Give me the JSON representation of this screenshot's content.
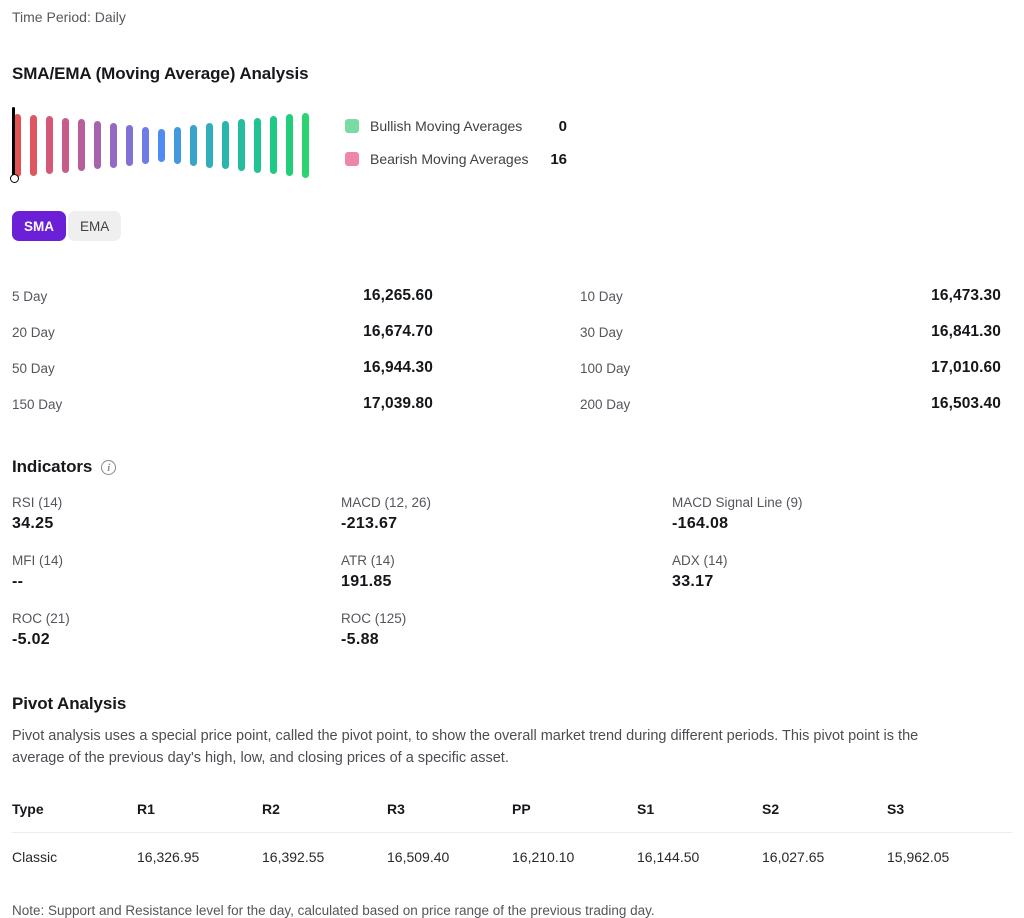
{
  "colors": {
    "accent_purple": "#6b1fd6",
    "toggle_inactive_bg": "#efefef",
    "bullish_swatch": "#79dba3",
    "bearish_swatch": "#ee87a5",
    "needle": "#000000"
  },
  "header": {
    "time_period": "Time Period: Daily"
  },
  "ma_section": {
    "title": "SMA/EMA (Moving Average) Analysis",
    "legend": {
      "bullish_label": "Bullish Moving Averages",
      "bullish_value": "0",
      "bearish_label": "Bearish Moving Averages",
      "bearish_value": "16"
    },
    "toggle": {
      "sma_label": "SMA",
      "ema_label": "EMA",
      "selected": "SMA"
    },
    "rows_left": [
      {
        "label": "5 Day",
        "value": "16,265.60"
      },
      {
        "label": "20 Day",
        "value": "16,674.70"
      },
      {
        "label": "50 Day",
        "value": "16,944.30"
      },
      {
        "label": "150 Day",
        "value": "17,039.80"
      }
    ],
    "rows_right": [
      {
        "label": "10 Day",
        "value": "16,473.30"
      },
      {
        "label": "30 Day",
        "value": "16,841.30"
      },
      {
        "label": "100 Day",
        "value": "17,010.60"
      },
      {
        "label": "200 Day",
        "value": "16,503.40"
      }
    ]
  },
  "chart_data": {
    "type": "gauge",
    "title": "SMA/EMA (Moving Average) Analysis",
    "bullish_count": 0,
    "bearish_count": 16,
    "needle_position": "far-left-bearish",
    "bars": [
      {
        "color": "#e45353",
        "height": 63
      },
      {
        "color": "#df5663",
        "height": 61
      },
      {
        "color": "#d45976",
        "height": 58
      },
      {
        "color": "#c75c88",
        "height": 55
      },
      {
        "color": "#b75f9b",
        "height": 52
      },
      {
        "color": "#a664af",
        "height": 48
      },
      {
        "color": "#9569c3",
        "height": 45
      },
      {
        "color": "#8170d5",
        "height": 41
      },
      {
        "color": "#6d7ce6",
        "height": 37
      },
      {
        "color": "#4e8bf5",
        "height": 33
      },
      {
        "color": "#4299dd",
        "height": 37
      },
      {
        "color": "#39a4cb",
        "height": 41
      },
      {
        "color": "#31aebb",
        "height": 45
      },
      {
        "color": "#2bb6ab",
        "height": 48
      },
      {
        "color": "#26bd9e",
        "height": 52
      },
      {
        "color": "#22c392",
        "height": 55
      },
      {
        "color": "#1fc986",
        "height": 58
      },
      {
        "color": "#23ce7b",
        "height": 62
      },
      {
        "color": "#2bd471",
        "height": 65
      }
    ]
  },
  "indicators": {
    "title": "Indicators",
    "items": [
      {
        "label": "RSI (14)",
        "value": "34.25"
      },
      {
        "label": "MACD (12, 26)",
        "value": "-213.67"
      },
      {
        "label": "MACD Signal Line (9)",
        "value": "-164.08"
      },
      {
        "label": "MFI (14)",
        "value": "--"
      },
      {
        "label": "ATR (14)",
        "value": "191.85"
      },
      {
        "label": "ADX (14)",
        "value": "33.17"
      },
      {
        "label": "ROC (21)",
        "value": "-5.02"
      },
      {
        "label": "ROC (125)",
        "value": "-5.88"
      }
    ]
  },
  "pivot": {
    "title": "Pivot Analysis",
    "description": "Pivot analysis uses a special price point, called the pivot point, to show the overall market trend during different periods. This pivot point is the average of the previous day's high, low, and closing prices of a specific asset.",
    "table": {
      "headers": [
        "Type",
        "R1",
        "R2",
        "R3",
        "PP",
        "S1",
        "S2",
        "S3"
      ],
      "rows": [
        {
          "type": "Classic",
          "values": [
            "16,326.95",
            "16,392.55",
            "16,509.40",
            "16,210.10",
            "16,144.50",
            "16,027.65",
            "15,962.05"
          ]
        }
      ]
    },
    "note": "Note: Support and Resistance level for the day, calculated based on price range of the previous trading day."
  }
}
